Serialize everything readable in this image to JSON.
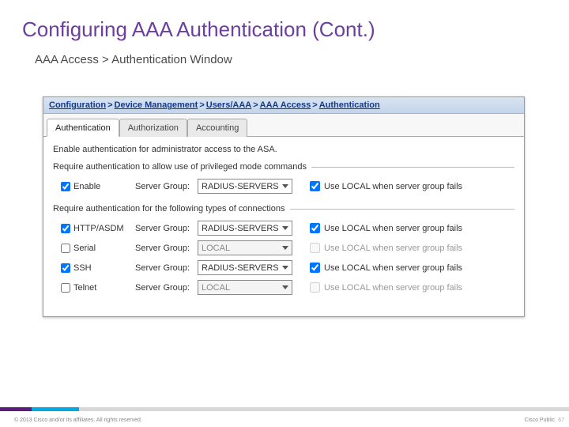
{
  "slide": {
    "title": "Configuring AAA Authentication (Cont.)",
    "subtitle": "AAA Access > Authentication Window"
  },
  "breadcrumb": {
    "parts": [
      "Configuration",
      "Device Management",
      "Users/AAA",
      "AAA Access",
      "Authentication"
    ]
  },
  "tabs": {
    "items": [
      {
        "label": "Authentication",
        "active": true
      },
      {
        "label": "Authorization",
        "active": false
      },
      {
        "label": "Accounting",
        "active": false
      }
    ]
  },
  "body": {
    "desc": "Enable authentication for administrator access to the ASA.",
    "fieldset1": {
      "legend": "Require authentication to allow use of privileged mode commands",
      "row": {
        "check_label": "Enable",
        "checked": true,
        "sg_label": "Server Group:",
        "sg_value": "RADIUS-SERVERS",
        "local_label": "Use LOCAL when server group fails",
        "local_checked": true,
        "enabled": true
      }
    },
    "fieldset2": {
      "legend": "Require authentication for the following types of connections",
      "rows": [
        {
          "check_label": "HTTP/ASDM",
          "checked": true,
          "sg_label": "Server Group:",
          "sg_value": "RADIUS-SERVERS",
          "local_label": "Use LOCAL when server group fails",
          "local_checked": true,
          "enabled": true
        },
        {
          "check_label": "Serial",
          "checked": false,
          "sg_label": "Server Group:",
          "sg_value": "LOCAL",
          "local_label": "Use LOCAL when server group fails",
          "local_checked": false,
          "enabled": false
        },
        {
          "check_label": "SSH",
          "checked": true,
          "sg_label": "Server Group:",
          "sg_value": "RADIUS-SERVERS",
          "local_label": "Use LOCAL when server group fails",
          "local_checked": true,
          "enabled": true
        },
        {
          "check_label": "Telnet",
          "checked": false,
          "sg_label": "Server Group:",
          "sg_value": "LOCAL",
          "local_label": "Use LOCAL when server group fails",
          "local_checked": false,
          "enabled": false
        }
      ]
    }
  },
  "footer": {
    "copyright": "© 2013 Cisco and/or its affiliates. All rights reserved.",
    "right": "Cisco Public",
    "page": "67"
  }
}
